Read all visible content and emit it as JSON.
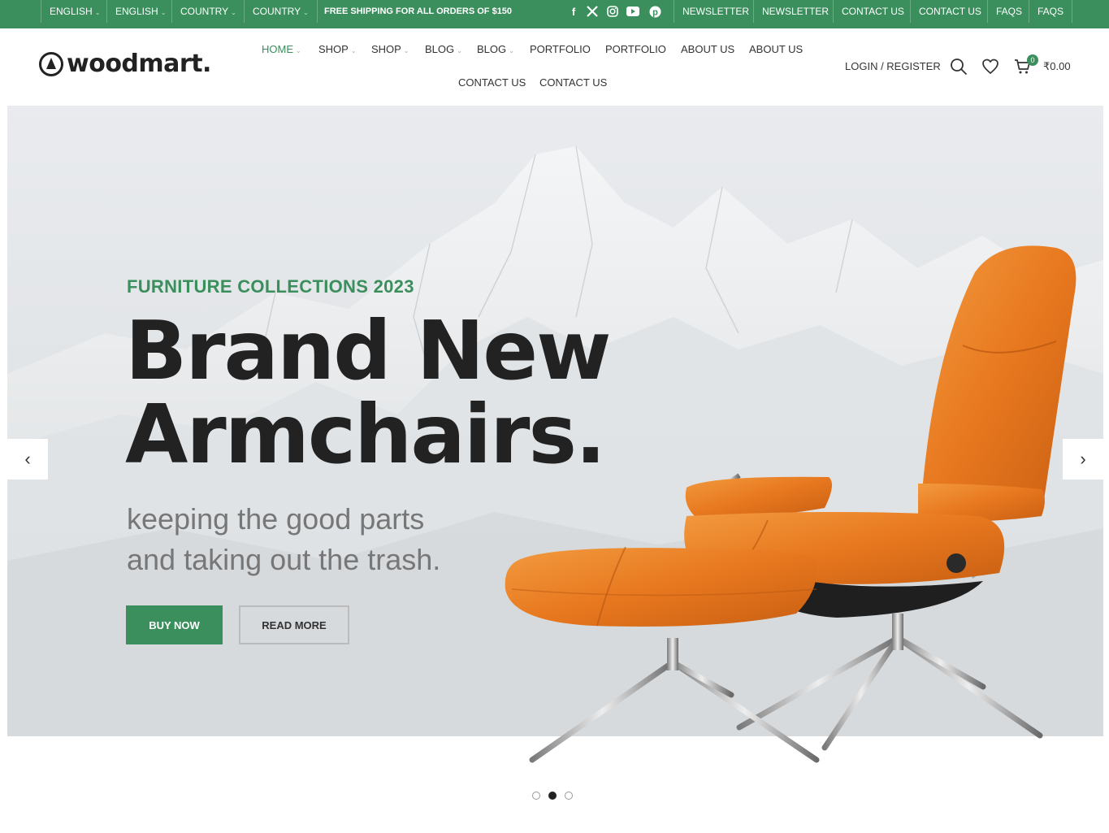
{
  "topbar": {
    "lang1": "ENGLISH",
    "lang2": "ENGLISH",
    "country1": "COUNTRY",
    "country2": "COUNTRY",
    "shipping": "FREE SHIPPING FOR ALL ORDERS OF $150",
    "links": [
      "NEWSLETTER",
      "NEWSLETTER",
      "CONTACT US",
      "CONTACT US",
      "FAQS",
      "FAQS"
    ]
  },
  "brand": {
    "name": "woodmart."
  },
  "nav": {
    "items": [
      "HOME",
      "SHOP",
      "SHOP",
      "BLOG",
      "BLOG",
      "PORTFOLIO",
      "PORTFOLIO",
      "ABOUT US",
      "ABOUT US",
      "CONTACT US",
      "CONTACT US"
    ]
  },
  "header": {
    "login": "LOGIN / REGISTER",
    "cart_count": "0",
    "cart_total": "₹0.00"
  },
  "hero": {
    "subtitle": "FURNITURE COLLECTIONS 2023",
    "title_line1": "Brand New",
    "title_line2": "Armchairs.",
    "desc_line1": "keeping the good parts",
    "desc_line2": "and taking out the trash.",
    "buy_label": "BUY NOW",
    "read_label": "READ MORE",
    "prev_arrow": "‹",
    "next_arrow": "›",
    "active_slide": 2,
    "total_slides": 3
  },
  "colors": {
    "accent": "#3a8f5c",
    "chair": "#e8781f"
  }
}
